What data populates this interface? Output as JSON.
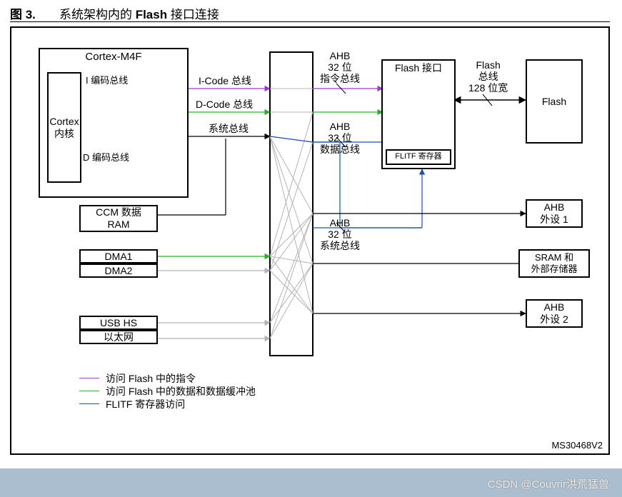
{
  "title_prefix": "图 3.",
  "title_main": "系统架构内的 ",
  "title_bold": "Flash ",
  "title_suffix": "接口连接",
  "cortex_m4f": "Cortex-M4F",
  "cortex_core_l1": "Cortex",
  "cortex_core_l2": "内核",
  "i_code_bus": "I 编码总线",
  "d_code_bus": "D 编码总线",
  "icode_label": "I-Code 总线",
  "dcode_label": "D-Code 总线",
  "system_bus": "系统总线",
  "ccm_l1": "CCM 数据",
  "ccm_l2": "RAM",
  "dma1": "DMA1",
  "dma2": "DMA2",
  "usb_hs": "USB HS",
  "ethernet": "以太网",
  "ahb32_instr_l1": "AHB",
  "ahb32_instr_l2": "32 位",
  "ahb32_instr_l3": "指令总线",
  "ahb32_data_l1": "AHB",
  "ahb32_data_l2": "32 位",
  "ahb32_data_l3": "数据总线",
  "ahb32_sys_l1": "AHB",
  "ahb32_sys_l2": "32 位",
  "ahb32_sys_l3": "系统总线",
  "flash_if": "Flash 接口",
  "flitf_reg": "FLITF 寄存器",
  "flash_bus_l1": "Flash",
  "flash_bus_l2": "总线",
  "flash_bus_l3": "128 位宽",
  "flash": "Flash",
  "ahb_periph1_l1": "AHB",
  "ahb_periph1_l2": "外设 1",
  "sram_l1": "SRAM 和",
  "sram_l2": "外部存储器",
  "ahb_periph2_l1": "AHB",
  "ahb_periph2_l2": "外设 2",
  "legend_purple": "访问 Flash 中的指令",
  "legend_green": "访问 Flash 中的数据和数据缓冲池",
  "legend_blue": "FLITF 寄存器访问",
  "doc_id": "MS30468V2",
  "watermark": "CSDN @Couvrir洪荒猛兽",
  "colors": {
    "purple": "#9b3bd6",
    "green": "#27b327",
    "blue": "#1b4fb3",
    "grey": "#b4b4b4"
  }
}
